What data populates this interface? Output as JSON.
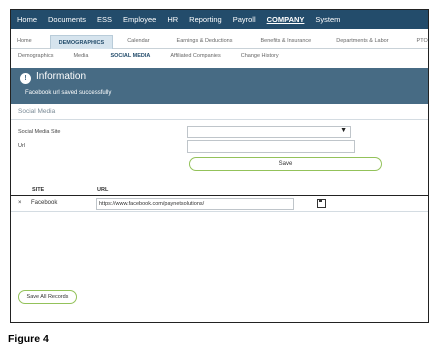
{
  "topnav": {
    "items": [
      "Home",
      "Documents",
      "ESS",
      "Employee",
      "HR",
      "Reporting",
      "Payroll",
      "COMPANY",
      "System"
    ],
    "active": "COMPANY"
  },
  "subtabs": {
    "items": [
      "Home",
      "DEMOGRAPHICS",
      "Calendar",
      "Earnings & Deductions",
      "Benefits & Insurance",
      "Departments & Labor",
      "PTO"
    ],
    "active": "DEMOGRAPHICS"
  },
  "tertiary": {
    "items": [
      "Demographics",
      "Media",
      "SOCIAL MEDIA",
      "Affiliated Companies",
      "Change History"
    ],
    "active": "SOCIAL MEDIA"
  },
  "info": {
    "title": "Information",
    "message": "Facebook url saved successfully",
    "icon": "alert-icon"
  },
  "section": {
    "title": "Social Media"
  },
  "form": {
    "site_label": "Social Media Site",
    "site_value": "",
    "url_label": "Url",
    "url_value": "",
    "save_label": "Save"
  },
  "table": {
    "columns": [
      "SITE",
      "URL"
    ],
    "rows": [
      {
        "remove": "×",
        "site": "Facebook",
        "url": "https://www.facebook.com/paynetsolutions/",
        "icon": "save-icon"
      }
    ]
  },
  "save_all_label": "Save All Records",
  "caption": "Figure 4",
  "colors": {
    "nav": "#234c6b",
    "info_bar": "#476b84",
    "button_border": "#93c25a"
  }
}
